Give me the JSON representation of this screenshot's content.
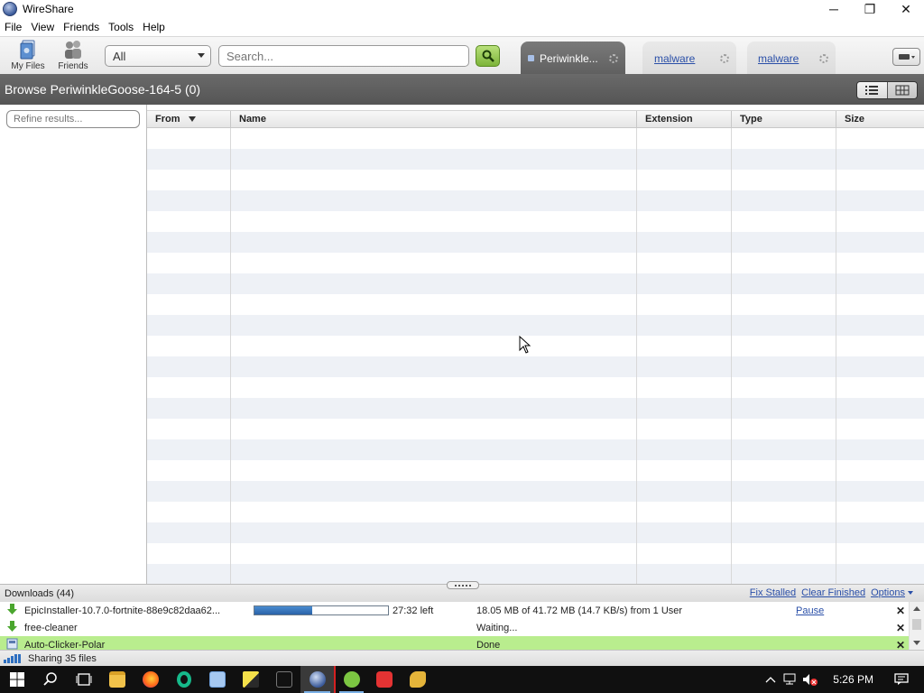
{
  "window": {
    "title": "WireShare",
    "controls": [
      "─",
      "❐",
      "✕"
    ]
  },
  "menu": [
    "File",
    "View",
    "Friends",
    "Tools",
    "Help"
  ],
  "toolbar": {
    "my_files": "My Files",
    "friends": "Friends",
    "filter_selected": "All",
    "search_placeholder": "Search...",
    "tabs": [
      {
        "label": "Periwinkle...",
        "active": true
      },
      {
        "label": "malware",
        "active": false
      },
      {
        "label": "malware",
        "active": false
      }
    ]
  },
  "browse": {
    "title": "Browse PeriwinkleGoose-164-5 (0)"
  },
  "left_panel": {
    "refine_placeholder": "Refine results..."
  },
  "table": {
    "columns": [
      "From",
      "Name",
      "Extension",
      "Type",
      "Size"
    ],
    "sorted_by": "From",
    "row_count": 0
  },
  "downloads": {
    "header": "Downloads (44)",
    "links": {
      "fix_stalled": "Fix Stalled",
      "clear_finished": "Clear Finished",
      "options": "Options"
    },
    "items": [
      {
        "name": "EpicInstaller-10.7.0-fortnite-88e9c82daa62...",
        "progress": 0.43,
        "time_left": "27:32 left",
        "status": "18.05 MB of 41.72 MB (14.7 KB/s) from 1 User",
        "action": "Pause",
        "state": "downloading"
      },
      {
        "name": "free-cleaner",
        "time_left": "",
        "status": "Waiting...",
        "action": "",
        "state": "waiting"
      },
      {
        "name": "Auto-Clicker-Polar",
        "time_left": "",
        "status": "Done",
        "action": "",
        "state": "done"
      }
    ]
  },
  "status": {
    "sharing": "Sharing 35 files"
  },
  "taskbar": {
    "clock": "5:26 PM"
  },
  "colors": {
    "accent": "#2a4fa8",
    "done_row": "#b9ed8e",
    "header_band": "#5e5e5e",
    "search_button": "#7db43a"
  }
}
